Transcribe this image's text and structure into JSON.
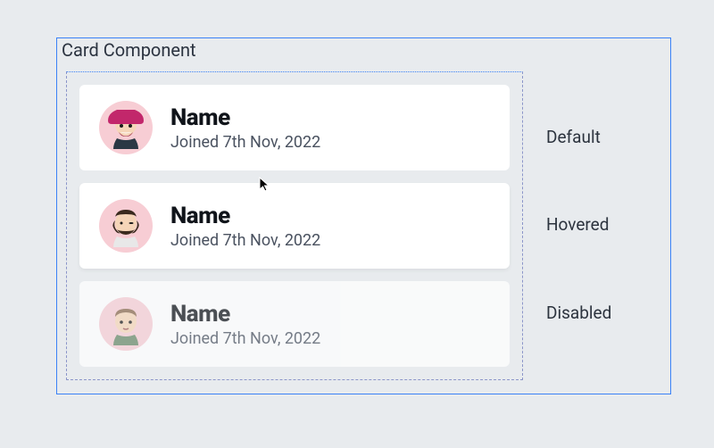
{
  "frameTitle": "Card Component",
  "variants": [
    {
      "name": "Name",
      "joined": "Joined 7th Nov, 2022",
      "stateLabel": "Default"
    },
    {
      "name": "Name",
      "joined": "Joined 7th Nov, 2022",
      "stateLabel": "Hovered"
    },
    {
      "name": "Name",
      "joined": "Joined 7th Nov, 2022",
      "stateLabel": "Disabled"
    }
  ]
}
